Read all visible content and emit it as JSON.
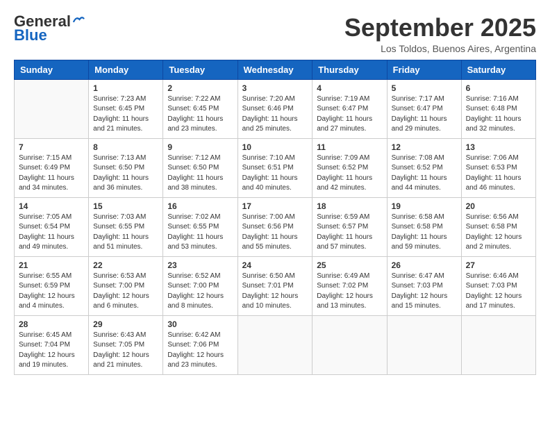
{
  "header": {
    "logo_general": "General",
    "logo_blue": "Blue",
    "month_title": "September 2025",
    "location": "Los Toldos, Buenos Aires, Argentina"
  },
  "days_of_week": [
    "Sunday",
    "Monday",
    "Tuesday",
    "Wednesday",
    "Thursday",
    "Friday",
    "Saturday"
  ],
  "weeks": [
    [
      {
        "day": "",
        "info": ""
      },
      {
        "day": "1",
        "info": "Sunrise: 7:23 AM\nSunset: 6:45 PM\nDaylight: 11 hours\nand 21 minutes."
      },
      {
        "day": "2",
        "info": "Sunrise: 7:22 AM\nSunset: 6:45 PM\nDaylight: 11 hours\nand 23 minutes."
      },
      {
        "day": "3",
        "info": "Sunrise: 7:20 AM\nSunset: 6:46 PM\nDaylight: 11 hours\nand 25 minutes."
      },
      {
        "day": "4",
        "info": "Sunrise: 7:19 AM\nSunset: 6:47 PM\nDaylight: 11 hours\nand 27 minutes."
      },
      {
        "day": "5",
        "info": "Sunrise: 7:17 AM\nSunset: 6:47 PM\nDaylight: 11 hours\nand 29 minutes."
      },
      {
        "day": "6",
        "info": "Sunrise: 7:16 AM\nSunset: 6:48 PM\nDaylight: 11 hours\nand 32 minutes."
      }
    ],
    [
      {
        "day": "7",
        "info": "Sunrise: 7:15 AM\nSunset: 6:49 PM\nDaylight: 11 hours\nand 34 minutes."
      },
      {
        "day": "8",
        "info": "Sunrise: 7:13 AM\nSunset: 6:50 PM\nDaylight: 11 hours\nand 36 minutes."
      },
      {
        "day": "9",
        "info": "Sunrise: 7:12 AM\nSunset: 6:50 PM\nDaylight: 11 hours\nand 38 minutes."
      },
      {
        "day": "10",
        "info": "Sunrise: 7:10 AM\nSunset: 6:51 PM\nDaylight: 11 hours\nand 40 minutes."
      },
      {
        "day": "11",
        "info": "Sunrise: 7:09 AM\nSunset: 6:52 PM\nDaylight: 11 hours\nand 42 minutes."
      },
      {
        "day": "12",
        "info": "Sunrise: 7:08 AM\nSunset: 6:52 PM\nDaylight: 11 hours\nand 44 minutes."
      },
      {
        "day": "13",
        "info": "Sunrise: 7:06 AM\nSunset: 6:53 PM\nDaylight: 11 hours\nand 46 minutes."
      }
    ],
    [
      {
        "day": "14",
        "info": "Sunrise: 7:05 AM\nSunset: 6:54 PM\nDaylight: 11 hours\nand 49 minutes."
      },
      {
        "day": "15",
        "info": "Sunrise: 7:03 AM\nSunset: 6:55 PM\nDaylight: 11 hours\nand 51 minutes."
      },
      {
        "day": "16",
        "info": "Sunrise: 7:02 AM\nSunset: 6:55 PM\nDaylight: 11 hours\nand 53 minutes."
      },
      {
        "day": "17",
        "info": "Sunrise: 7:00 AM\nSunset: 6:56 PM\nDaylight: 11 hours\nand 55 minutes."
      },
      {
        "day": "18",
        "info": "Sunrise: 6:59 AM\nSunset: 6:57 PM\nDaylight: 11 hours\nand 57 minutes."
      },
      {
        "day": "19",
        "info": "Sunrise: 6:58 AM\nSunset: 6:58 PM\nDaylight: 11 hours\nand 59 minutes."
      },
      {
        "day": "20",
        "info": "Sunrise: 6:56 AM\nSunset: 6:58 PM\nDaylight: 12 hours\nand 2 minutes."
      }
    ],
    [
      {
        "day": "21",
        "info": "Sunrise: 6:55 AM\nSunset: 6:59 PM\nDaylight: 12 hours\nand 4 minutes."
      },
      {
        "day": "22",
        "info": "Sunrise: 6:53 AM\nSunset: 7:00 PM\nDaylight: 12 hours\nand 6 minutes."
      },
      {
        "day": "23",
        "info": "Sunrise: 6:52 AM\nSunset: 7:00 PM\nDaylight: 12 hours\nand 8 minutes."
      },
      {
        "day": "24",
        "info": "Sunrise: 6:50 AM\nSunset: 7:01 PM\nDaylight: 12 hours\nand 10 minutes."
      },
      {
        "day": "25",
        "info": "Sunrise: 6:49 AM\nSunset: 7:02 PM\nDaylight: 12 hours\nand 13 minutes."
      },
      {
        "day": "26",
        "info": "Sunrise: 6:47 AM\nSunset: 7:03 PM\nDaylight: 12 hours\nand 15 minutes."
      },
      {
        "day": "27",
        "info": "Sunrise: 6:46 AM\nSunset: 7:03 PM\nDaylight: 12 hours\nand 17 minutes."
      }
    ],
    [
      {
        "day": "28",
        "info": "Sunrise: 6:45 AM\nSunset: 7:04 PM\nDaylight: 12 hours\nand 19 minutes."
      },
      {
        "day": "29",
        "info": "Sunrise: 6:43 AM\nSunset: 7:05 PM\nDaylight: 12 hours\nand 21 minutes."
      },
      {
        "day": "30",
        "info": "Sunrise: 6:42 AM\nSunset: 7:06 PM\nDaylight: 12 hours\nand 23 minutes."
      },
      {
        "day": "",
        "info": ""
      },
      {
        "day": "",
        "info": ""
      },
      {
        "day": "",
        "info": ""
      },
      {
        "day": "",
        "info": ""
      }
    ]
  ]
}
